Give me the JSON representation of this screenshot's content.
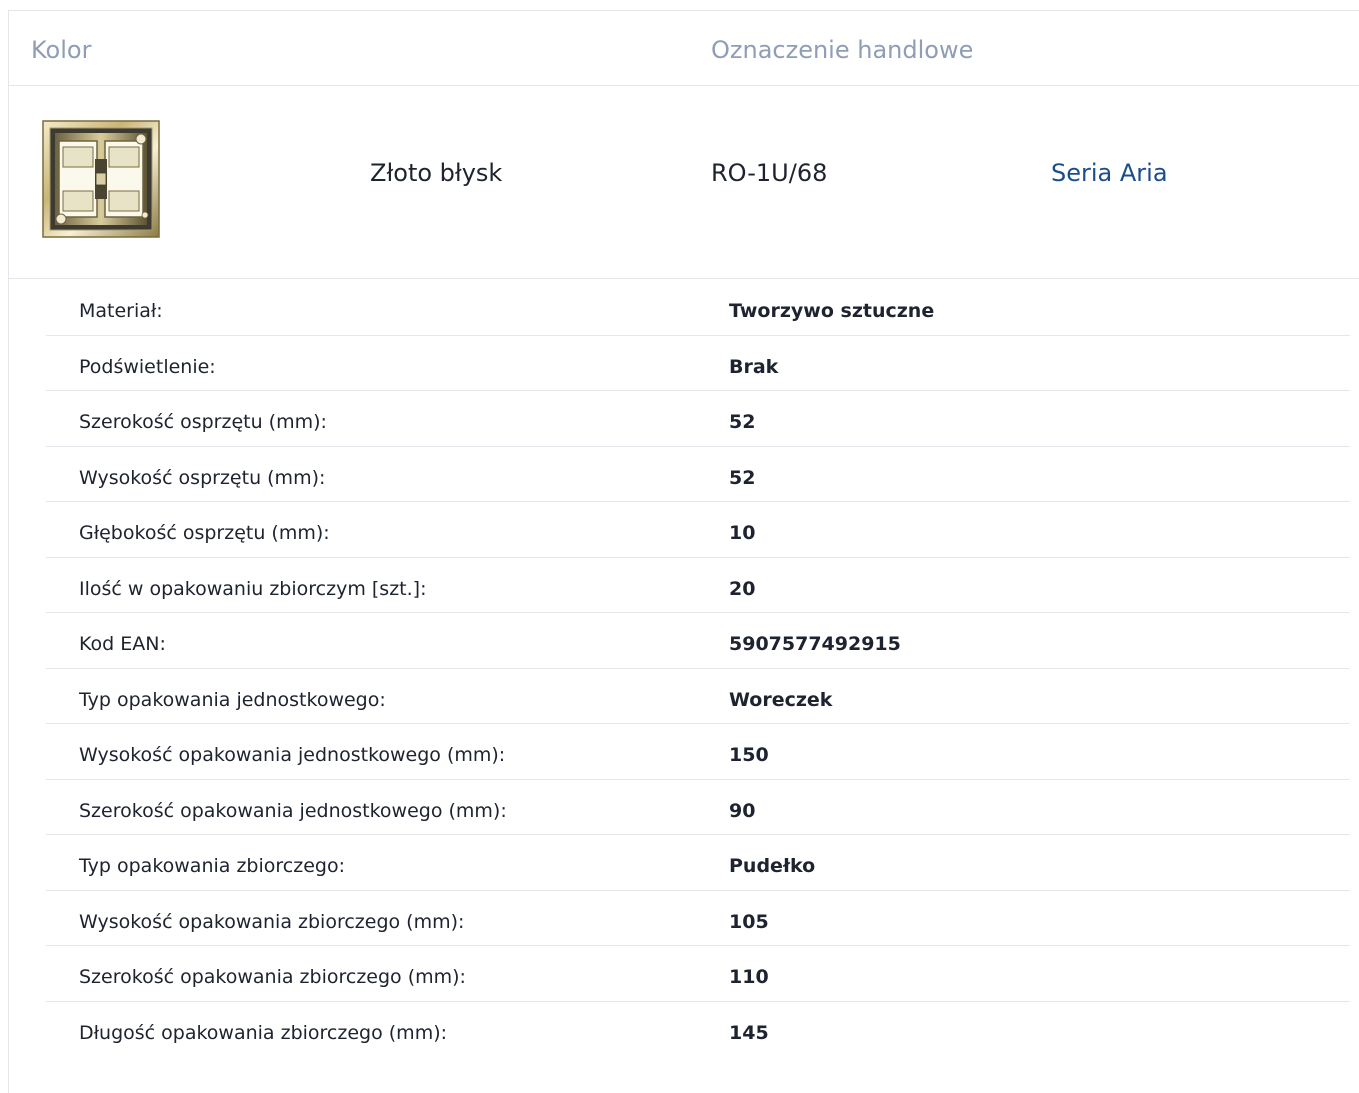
{
  "table_header": {
    "kolor": "Kolor",
    "oznaczenie": "Oznaczenie handlowe"
  },
  "product": {
    "thumbnail_icon": "gold-double-frame-icon",
    "color_name": "Złoto błysk",
    "trade_code": "RO-1U/68",
    "series_link": "Seria Aria",
    "series_link_color": "#1b4c8c"
  },
  "specs": [
    {
      "label": "Materiał:",
      "value": "Tworzywo sztuczne"
    },
    {
      "label": "Podświetlenie:",
      "value": "Brak"
    },
    {
      "label": "Szerokość osprzętu (mm):",
      "value": "52"
    },
    {
      "label": "Wysokość osprzętu (mm):",
      "value": "52"
    },
    {
      "label": "Głębokość osprzętu (mm):",
      "value": "10"
    },
    {
      "label": "Ilość w opakowaniu zbiorczym [szt.]:",
      "value": "20"
    },
    {
      "label": "Kod EAN:",
      "value": "5907577492915"
    },
    {
      "label": "Typ opakowania jednostkowego:",
      "value": "Woreczek"
    },
    {
      "label": "Wysokość opakowania jednostkowego (mm):",
      "value": "150"
    },
    {
      "label": "Szerokość opakowania jednostkowego (mm):",
      "value": "90"
    },
    {
      "label": "Typ opakowania zbiorczego:",
      "value": "Pudełko"
    },
    {
      "label": "Wysokość opakowania zbiorczego (mm):",
      "value": "105"
    },
    {
      "label": "Szerokość opakowania zbiorczego (mm):",
      "value": "110"
    },
    {
      "label": "Długość opakowania zbiorczego (mm):",
      "value": "145"
    }
  ]
}
